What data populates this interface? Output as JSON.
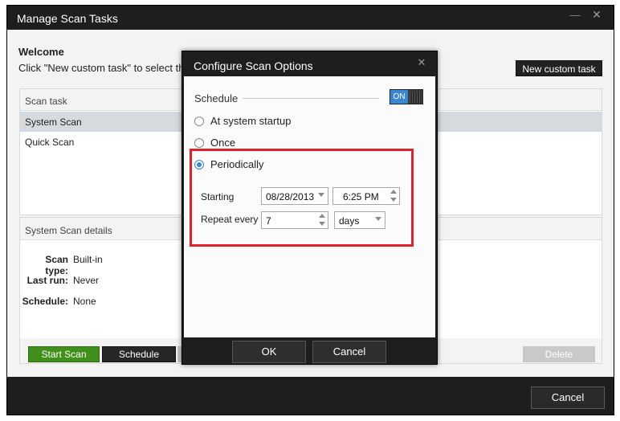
{
  "main_window": {
    "title": "Manage Scan Tasks",
    "minimize_glyph": "—",
    "close_glyph": "✕"
  },
  "welcome": {
    "title": "Welcome",
    "text": "Click \"New custom task\" to select the i"
  },
  "toolbar": {
    "new_custom_task_label": "New custom task"
  },
  "task_list": {
    "header": "Scan task",
    "items": [
      {
        "label": "System Scan",
        "selected": true
      },
      {
        "label": "Quick Scan",
        "selected": false
      }
    ]
  },
  "details": {
    "header": "System Scan details",
    "rows": [
      {
        "key": "Scan type:",
        "value": "Built-in"
      },
      {
        "key": "Last run:",
        "value": "Never"
      },
      {
        "key": "Schedule:",
        "value": "None"
      }
    ],
    "start_scan_label": "Start Scan",
    "schedule_label": "Schedule",
    "delete_label": "Delete"
  },
  "main_footer": {
    "cancel_label": "Cancel"
  },
  "dialog": {
    "title": "Configure Scan Options",
    "close_glyph": "✕",
    "schedule_label": "Schedule",
    "toggle_label": "ON",
    "options": [
      {
        "label": "At system startup",
        "checked": false
      },
      {
        "label": "Once",
        "checked": false
      },
      {
        "label": "Periodically",
        "checked": true
      }
    ],
    "starting_label": "Starting",
    "start_date": "08/28/2013",
    "start_time": "6:25 PM",
    "repeat_label": "Repeat every",
    "repeat_value": "7",
    "repeat_unit": "days",
    "ok_label": "OK",
    "cancel_label": "Cancel"
  },
  "colors": {
    "accent_blue": "#3c87d4",
    "start_green": "#3f8f1a",
    "highlight_red": "#e3202e",
    "titlebar_dark": "#1e1e1e"
  }
}
